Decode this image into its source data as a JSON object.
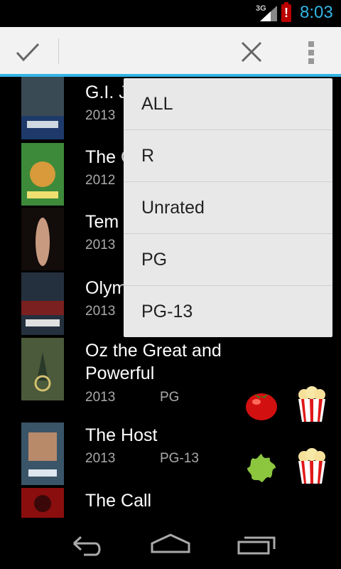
{
  "status_bar": {
    "network": "3G",
    "time": "8:03",
    "battery_alert": "!"
  },
  "action_bar": {
    "done_icon": "check-icon",
    "cancel_icon": "close-icon",
    "overflow_icon": "overflow-menu-icon"
  },
  "movies": [
    {
      "title": "G.I. J",
      "year": "2013",
      "rating": ""
    },
    {
      "title": "The C",
      "year": "2012",
      "rating": ""
    },
    {
      "title": "Tem",
      "year": "2013",
      "rating": ""
    },
    {
      "title": "Olym",
      "year": "2013",
      "rating": ""
    },
    {
      "title": "Oz the Great and Powerful",
      "year": "2013",
      "rating": "PG",
      "critic_icon": "fresh-tomato-icon",
      "audience_icon": "popcorn-icon"
    },
    {
      "title": "The Host",
      "year": "2013",
      "rating": "PG-13",
      "critic_icon": "rotten-splat-icon",
      "audience_icon": "popcorn-icon"
    },
    {
      "title": "The Call",
      "year": "",
      "rating": ""
    }
  ],
  "dropdown": {
    "options": [
      "ALL",
      "R",
      "Unrated",
      "PG",
      "PG-13"
    ]
  },
  "nav_bar": {
    "back_icon": "back-icon",
    "home_icon": "home-icon",
    "recents_icon": "recents-icon"
  },
  "colors": {
    "accent": "#33b5e5",
    "action_bar_bg": "#f2f2f2",
    "dropdown_bg": "#e8e8e8"
  }
}
